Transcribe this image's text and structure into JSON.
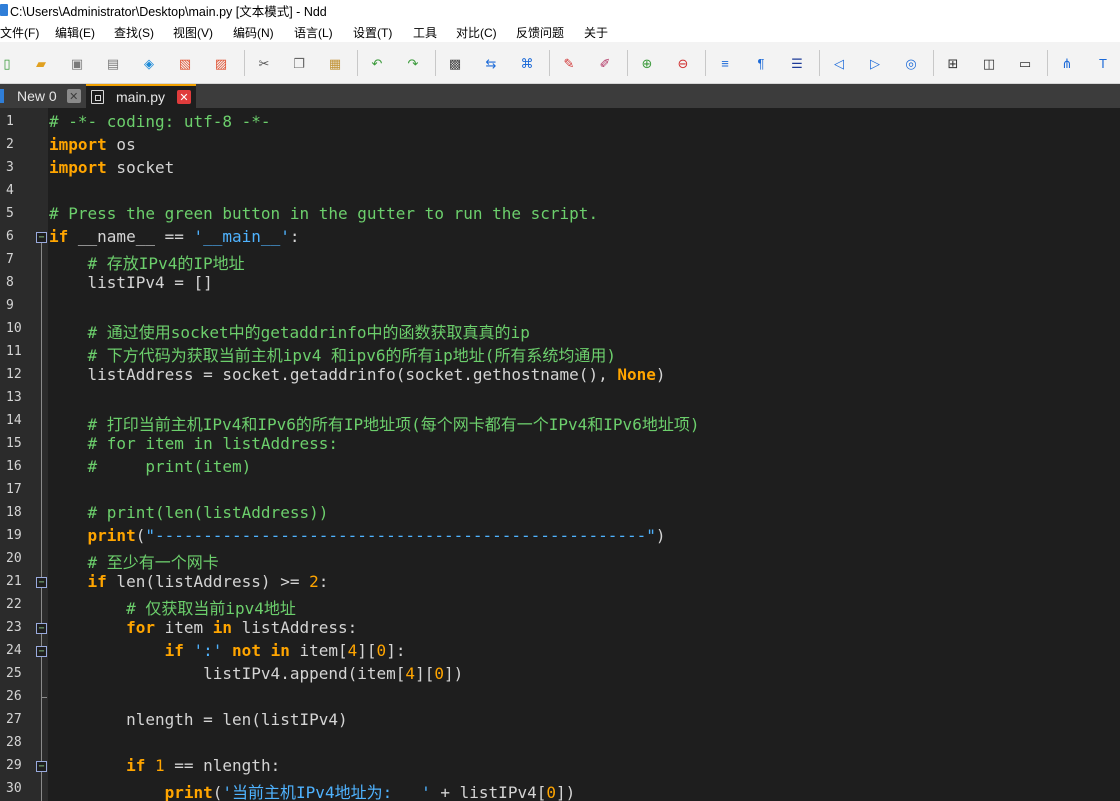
{
  "window": {
    "title": "C:\\Users\\Administrator\\Desktop\\main.py [文本模式] - Ndd"
  },
  "menu": [
    "文件(F)",
    "编辑(E)",
    "查找(S)",
    "视图(V)",
    "编码(N)",
    "语言(L)",
    "设置(T)",
    "工具",
    "对比(C)",
    "反馈问题",
    "关于"
  ],
  "toolbar": {
    "buttons": [
      {
        "name": "new-file-icon",
        "glyph": "▯",
        "color": "#3a9a3a"
      },
      {
        "name": "open-file-icon",
        "glyph": "▰",
        "color": "#e0a020"
      },
      {
        "name": "save-icon",
        "glyph": "▣",
        "color": "#7a7a7a"
      },
      {
        "name": "save-all-icon",
        "glyph": "▤",
        "color": "#7a7a7a"
      },
      {
        "name": "encoding-icon",
        "glyph": "◈",
        "color": "#1c8ad8"
      },
      {
        "name": "close-file-icon",
        "glyph": "▧",
        "color": "#e05030"
      },
      {
        "name": "close-all-icon",
        "glyph": "▨",
        "color": "#e05030"
      },
      {
        "name": "cut-icon",
        "glyph": "✂",
        "color": "#555555"
      },
      {
        "name": "copy-icon",
        "glyph": "❐",
        "color": "#666666"
      },
      {
        "name": "paste-icon",
        "glyph": "▦",
        "color": "#c09030"
      },
      {
        "name": "undo-icon",
        "glyph": "↶",
        "color": "#3a9a3a"
      },
      {
        "name": "redo-icon",
        "glyph": "↷",
        "color": "#3a9a3a"
      },
      {
        "name": "find-icon",
        "glyph": "▩",
        "color": "#444444"
      },
      {
        "name": "replace-icon",
        "glyph": "⇆",
        "color": "#1c6ad8"
      },
      {
        "name": "bookmark-icon",
        "glyph": "⌘",
        "color": "#1c6ad8"
      },
      {
        "name": "mark-icon",
        "glyph": "✎",
        "color": "#d03030"
      },
      {
        "name": "clear-mark-icon",
        "glyph": "✐",
        "color": "#b03060"
      },
      {
        "name": "zoom-in-icon",
        "glyph": "⊕",
        "color": "#3a9a3a"
      },
      {
        "name": "zoom-out-icon",
        "glyph": "⊖",
        "color": "#d03030"
      },
      {
        "name": "word-wrap-icon",
        "glyph": "≡",
        "color": "#1c6ad8"
      },
      {
        "name": "show-symbols-icon",
        "glyph": "¶",
        "color": "#1c6ad8"
      },
      {
        "name": "indent-guide-icon",
        "glyph": "☰",
        "color": "#1c3a98"
      },
      {
        "name": "prev-icon",
        "glyph": "◁",
        "color": "#1c6ad8"
      },
      {
        "name": "next-icon",
        "glyph": "▷",
        "color": "#1c6ad8"
      },
      {
        "name": "goto-icon",
        "glyph": "◎",
        "color": "#1c6ad8"
      },
      {
        "name": "column-mode-icon",
        "glyph": "⊞",
        "color": "#333333"
      },
      {
        "name": "split-view-icon",
        "glyph": "◫",
        "color": "#333333"
      },
      {
        "name": "monitor-icon",
        "glyph": "▭",
        "color": "#333333"
      },
      {
        "name": "tree-icon",
        "glyph": "⋔",
        "color": "#1c6ad8"
      },
      {
        "name": "text-mode-icon",
        "glyph": "T",
        "color": "#1c6ad8"
      }
    ]
  },
  "tabs": [
    {
      "label": "New 0",
      "active": false
    },
    {
      "label": "main.py",
      "active": true
    }
  ],
  "editor": {
    "lines": [
      {
        "num": "1",
        "tokens": [
          {
            "t": "cmt",
            "s": "# -*- coding: utf-8 -*-"
          }
        ]
      },
      {
        "num": "2",
        "tokens": [
          {
            "t": "kw",
            "s": "import"
          },
          {
            "t": "plain",
            "s": " os"
          }
        ]
      },
      {
        "num": "3",
        "tokens": [
          {
            "t": "kw",
            "s": "import"
          },
          {
            "t": "plain",
            "s": " socket"
          }
        ]
      },
      {
        "num": "4",
        "tokens": []
      },
      {
        "num": "5",
        "tokens": [
          {
            "t": "cmt",
            "s": "# Press the green button in the gutter to run the script."
          }
        ]
      },
      {
        "num": "6",
        "tokens": [
          {
            "t": "kw",
            "s": "if"
          },
          {
            "t": "plain",
            "s": " __name__ == "
          },
          {
            "t": "str",
            "s": "'__main__'"
          },
          {
            "t": "plain",
            "s": ":"
          }
        ]
      },
      {
        "num": "7",
        "tokens": [
          {
            "t": "plain",
            "s": "    "
          },
          {
            "t": "cmt",
            "s": "# 存放IPv4的IP地址"
          }
        ]
      },
      {
        "num": "8",
        "tokens": [
          {
            "t": "plain",
            "s": "    listIPv4 = []"
          }
        ]
      },
      {
        "num": "9",
        "tokens": []
      },
      {
        "num": "10",
        "tokens": [
          {
            "t": "plain",
            "s": "    "
          },
          {
            "t": "cmt",
            "s": "# 通过使用socket中的getaddrinfo中的函数获取真真的ip"
          }
        ]
      },
      {
        "num": "11",
        "tokens": [
          {
            "t": "plain",
            "s": "    "
          },
          {
            "t": "cmt",
            "s": "# 下方代码为获取当前主机ipv4 和ipv6的所有ip地址(所有系统均通用)"
          }
        ]
      },
      {
        "num": "12",
        "tokens": [
          {
            "t": "plain",
            "s": "    listAddress = socket.getaddrinfo(socket.gethostname(), "
          },
          {
            "t": "kw",
            "s": "None"
          },
          {
            "t": "plain",
            "s": ")"
          }
        ]
      },
      {
        "num": "13",
        "tokens": []
      },
      {
        "num": "14",
        "tokens": [
          {
            "t": "plain",
            "s": "    "
          },
          {
            "t": "cmt",
            "s": "# 打印当前主机IPv4和IPv6的所有IP地址项(每个网卡都有一个IPv4和IPv6地址项)"
          }
        ]
      },
      {
        "num": "15",
        "tokens": [
          {
            "t": "plain",
            "s": "    "
          },
          {
            "t": "cmt",
            "s": "# for item in listAddress:"
          }
        ]
      },
      {
        "num": "16",
        "tokens": [
          {
            "t": "plain",
            "s": "    "
          },
          {
            "t": "cmt",
            "s": "#     print(item)"
          }
        ]
      },
      {
        "num": "17",
        "tokens": []
      },
      {
        "num": "18",
        "tokens": [
          {
            "t": "plain",
            "s": "    "
          },
          {
            "t": "cmt",
            "s": "# print(len(listAddress))"
          }
        ]
      },
      {
        "num": "19",
        "tokens": [
          {
            "t": "plain",
            "s": "    "
          },
          {
            "t": "kw",
            "s": "print"
          },
          {
            "t": "plain",
            "s": "("
          },
          {
            "t": "str",
            "s": "\"---------------------------------------------------\""
          },
          {
            "t": "plain",
            "s": ")"
          }
        ]
      },
      {
        "num": "20",
        "tokens": [
          {
            "t": "plain",
            "s": "    "
          },
          {
            "t": "cmt",
            "s": "# 至少有一个网卡"
          }
        ]
      },
      {
        "num": "21",
        "tokens": [
          {
            "t": "plain",
            "s": "    "
          },
          {
            "t": "kw",
            "s": "if"
          },
          {
            "t": "plain",
            "s": " len(listAddress) >= "
          },
          {
            "t": "num",
            "s": "2"
          },
          {
            "t": "plain",
            "s": ":"
          }
        ]
      },
      {
        "num": "22",
        "tokens": [
          {
            "t": "plain",
            "s": "        "
          },
          {
            "t": "cmt",
            "s": "# 仅获取当前ipv4地址"
          }
        ]
      },
      {
        "num": "23",
        "tokens": [
          {
            "t": "plain",
            "s": "        "
          },
          {
            "t": "kw",
            "s": "for"
          },
          {
            "t": "plain",
            "s": " item "
          },
          {
            "t": "kw",
            "s": "in"
          },
          {
            "t": "plain",
            "s": " listAddress:"
          }
        ]
      },
      {
        "num": "24",
        "tokens": [
          {
            "t": "plain",
            "s": "            "
          },
          {
            "t": "kw",
            "s": "if"
          },
          {
            "t": "plain",
            "s": " "
          },
          {
            "t": "str",
            "s": "':'"
          },
          {
            "t": "plain",
            "s": " "
          },
          {
            "t": "kw",
            "s": "not in"
          },
          {
            "t": "plain",
            "s": " item["
          },
          {
            "t": "num",
            "s": "4"
          },
          {
            "t": "plain",
            "s": "]["
          },
          {
            "t": "num",
            "s": "0"
          },
          {
            "t": "plain",
            "s": "]:"
          }
        ]
      },
      {
        "num": "25",
        "tokens": [
          {
            "t": "plain",
            "s": "                listIPv4.append(item["
          },
          {
            "t": "num",
            "s": "4"
          },
          {
            "t": "plain",
            "s": "]["
          },
          {
            "t": "num",
            "s": "0"
          },
          {
            "t": "plain",
            "s": "])"
          }
        ]
      },
      {
        "num": "26",
        "tokens": []
      },
      {
        "num": "27",
        "tokens": [
          {
            "t": "plain",
            "s": "        nlength = len(listIPv4)"
          }
        ]
      },
      {
        "num": "28",
        "tokens": []
      },
      {
        "num": "29",
        "tokens": [
          {
            "t": "plain",
            "s": "        "
          },
          {
            "t": "kw",
            "s": "if"
          },
          {
            "t": "plain",
            "s": " "
          },
          {
            "t": "num",
            "s": "1"
          },
          {
            "t": "plain",
            "s": " == nlength:"
          }
        ]
      },
      {
        "num": "30",
        "tokens": [
          {
            "t": "plain",
            "s": "            "
          },
          {
            "t": "kw",
            "s": "print"
          },
          {
            "t": "plain",
            "s": "("
          },
          {
            "t": "str",
            "s": "'当前主机IPv4地址为:   '"
          },
          {
            "t": "plain",
            "s": " + listIPv4["
          },
          {
            "t": "num",
            "s": "0"
          },
          {
            "t": "plain",
            "s": "])"
          }
        ]
      }
    ],
    "fold_markers": [
      "6",
      "21",
      "23",
      "24",
      "29"
    ]
  }
}
